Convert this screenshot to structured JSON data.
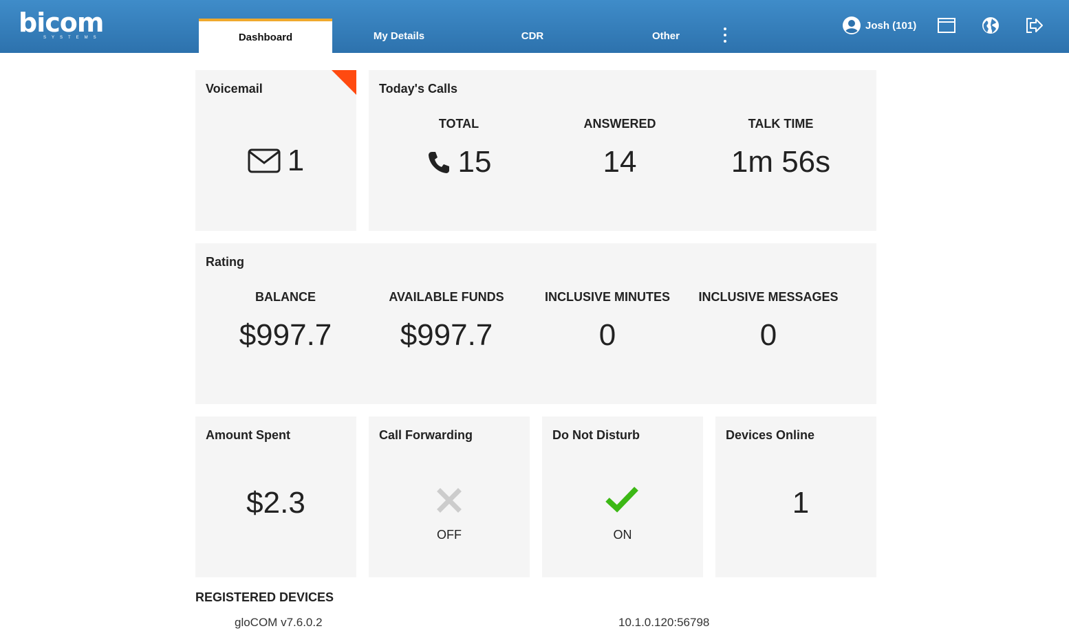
{
  "header": {
    "logo_text": "bicom",
    "logo_sub": "SYSTEMS",
    "tabs": [
      {
        "label": "Dashboard",
        "active": true
      },
      {
        "label": "My Details",
        "active": false
      },
      {
        "label": "CDR",
        "active": false
      },
      {
        "label": "Other",
        "active": false
      }
    ],
    "user_label": "Josh (101)",
    "icons": [
      "user-avatar-icon",
      "window-icon",
      "globe-icon",
      "logout-icon",
      "more-vertical-icon"
    ]
  },
  "voicemail": {
    "title": "Voicemail",
    "count": "1",
    "icon": "envelope-icon",
    "corner_color": "#ff4a10"
  },
  "todays_calls": {
    "title": "Today's Calls",
    "total_label": "TOTAL",
    "total_value": "15",
    "icon": "phone-icon",
    "answered_label": "ANSWERED",
    "answered_value": "14",
    "talk_time_label": "TALK TIME",
    "talk_time_value": "1m 56s"
  },
  "rating": {
    "title": "Rating",
    "items": [
      {
        "label": "BALANCE",
        "value": "$997.7"
      },
      {
        "label": "AVAILABLE FUNDS",
        "value": "$997.7"
      },
      {
        "label": "INCLUSIVE MINUTES",
        "value": "0"
      },
      {
        "label": "INCLUSIVE MESSAGES",
        "value": "0"
      }
    ]
  },
  "amount_spent": {
    "title": "Amount Spent",
    "value": "$2.3"
  },
  "call_forwarding": {
    "title": "Call Forwarding",
    "status": "OFF",
    "icon": "x-icon",
    "color": "#cccccc"
  },
  "do_not_disturb": {
    "title": "Do Not Disturb",
    "status": "ON",
    "icon": "check-icon",
    "color": "#3cb815"
  },
  "devices_online": {
    "title": "Devices Online",
    "value": "1"
  },
  "registered_devices": {
    "title": "REGISTERED DEVICES",
    "rows": [
      {
        "name": "gloCOM v7.6.0.2",
        "address": "10.1.0.120:56798"
      }
    ]
  },
  "colors": {
    "header_top": "#3f8cc9",
    "header_bottom": "#2d72ad",
    "active_tab_accent": "#f0a92c",
    "card_bg": "#f5f5f5"
  }
}
